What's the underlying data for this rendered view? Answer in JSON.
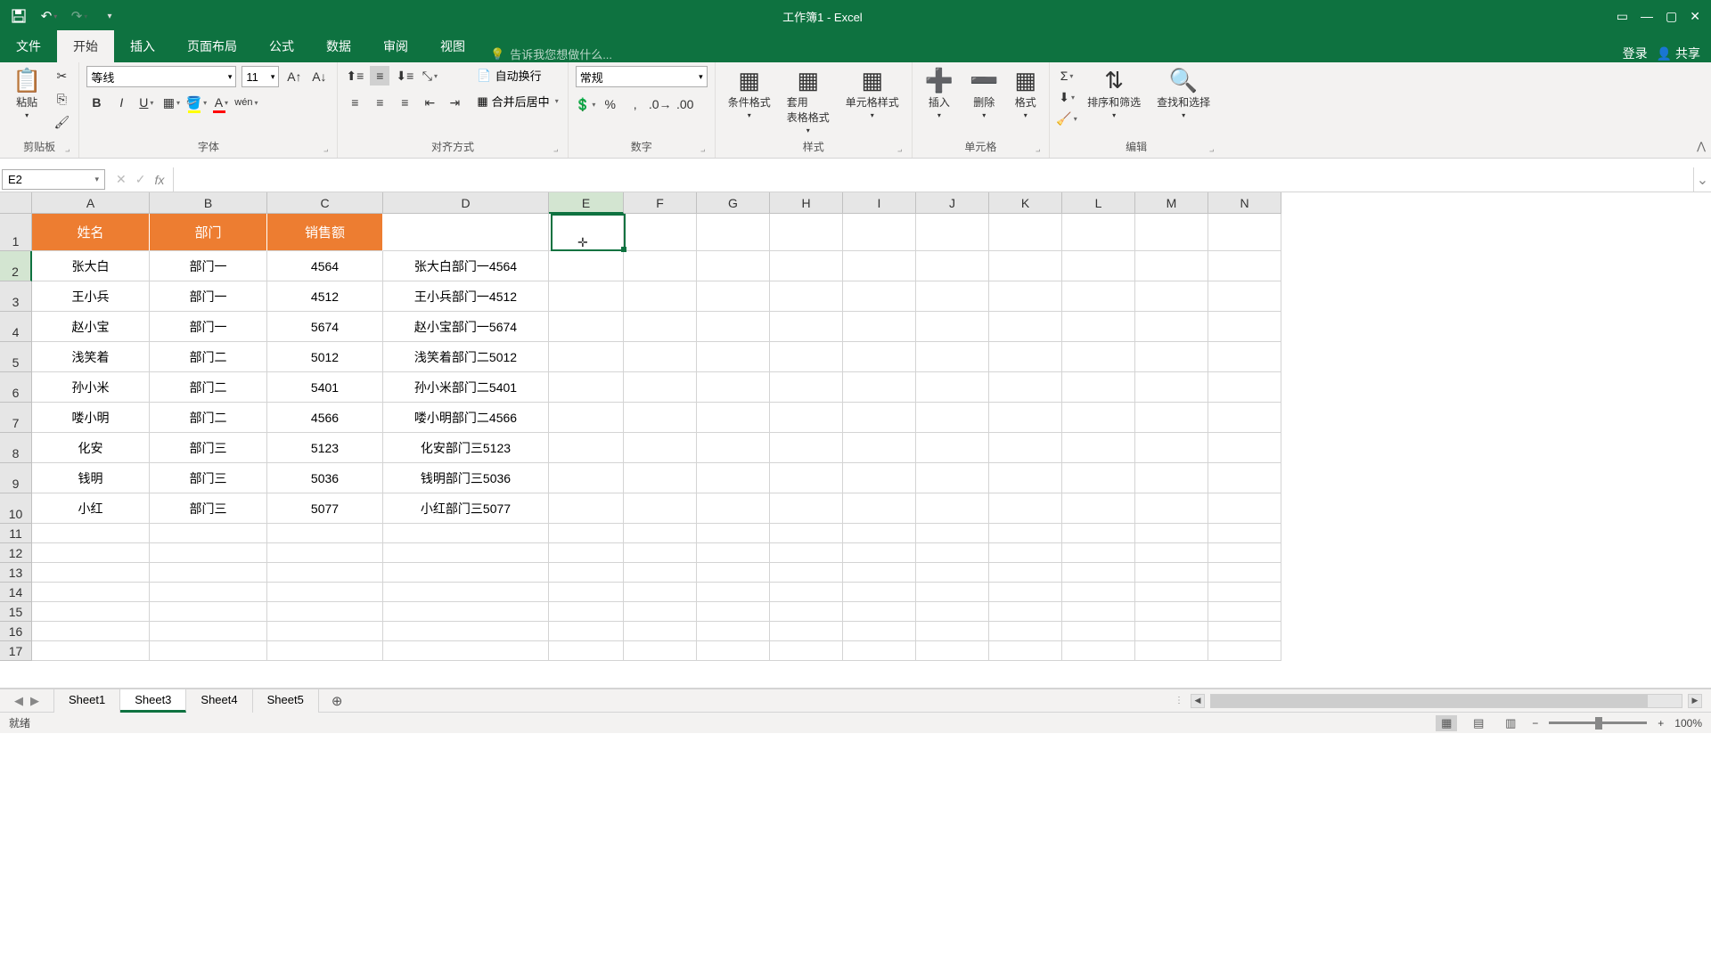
{
  "title": "工作簿1 - Excel",
  "qat": {
    "save": "💾",
    "undo": "↶",
    "redo": "↷"
  },
  "tabs": {
    "file": "文件",
    "home": "开始",
    "insert": "插入",
    "layout": "页面布局",
    "formulas": "公式",
    "data": "数据",
    "review": "审阅",
    "view": "视图",
    "tellme": "告诉我您想做什么...",
    "login": "登录",
    "share": "共享"
  },
  "ribbon": {
    "clipboard": {
      "paste": "粘贴",
      "label": "剪贴板"
    },
    "font": {
      "name": "等线",
      "size": "11",
      "label": "字体",
      "pinyin": "wén"
    },
    "align": {
      "label": "对齐方式",
      "wrap": "自动换行",
      "merge": "合并后居中"
    },
    "number": {
      "format": "常规",
      "label": "数字"
    },
    "styles": {
      "cond": "条件格式",
      "table": "套用\n表格格式",
      "cell": "单元格样式",
      "label": "样式"
    },
    "cells": {
      "insert": "插入",
      "delete": "删除",
      "format": "格式",
      "label": "单元格"
    },
    "editing": {
      "sort": "排序和筛选",
      "find": "查找和选择",
      "label": "编辑"
    }
  },
  "namebox": "E2",
  "columns": [
    "A",
    "B",
    "C",
    "D",
    "E",
    "F",
    "G",
    "H",
    "I",
    "J",
    "K",
    "L",
    "M",
    "N"
  ],
  "headers": {
    "name": "姓名",
    "dept": "部门",
    "sales": "销售额"
  },
  "rows": [
    {
      "a": "张大白",
      "b": "部门一",
      "c": "4564",
      "d": "张大白部门一4564"
    },
    {
      "a": "王小兵",
      "b": "部门一",
      "c": "4512",
      "d": "王小兵部门一4512"
    },
    {
      "a": "赵小宝",
      "b": "部门一",
      "c": "5674",
      "d": "赵小宝部门一5674"
    },
    {
      "a": "浅笑着",
      "b": "部门二",
      "c": "5012",
      "d": "浅笑着部门二5012"
    },
    {
      "a": "孙小米",
      "b": "部门二",
      "c": "5401",
      "d": "孙小米部门二5401"
    },
    {
      "a": "喽小明",
      "b": "部门二",
      "c": "4566",
      "d": "喽小明部门二4566"
    },
    {
      "a": "化安",
      "b": "部门三",
      "c": "5123",
      "d": "化安部门三5123"
    },
    {
      "a": "钱明",
      "b": "部门三",
      "c": "5036",
      "d": "钱明部门三5036"
    },
    {
      "a": "小红",
      "b": "部门三",
      "c": "5077",
      "d": "小红部门三5077"
    }
  ],
  "sheets": [
    "Sheet1",
    "Sheet3",
    "Sheet4",
    "Sheet5"
  ],
  "active_sheet": "Sheet3",
  "status": {
    "ready": "就绪",
    "zoom": "100%"
  }
}
